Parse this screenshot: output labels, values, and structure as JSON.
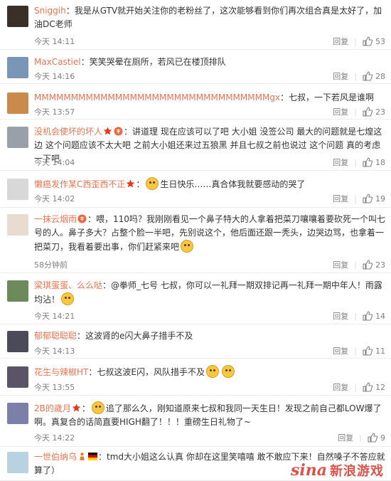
{
  "comments": [
    {
      "user": "Sniggih",
      "sep": "：",
      "text": "我是从GTV就开始关注你的老粉丝了，这次能够看到你们再次组合真是太好了，加油DC老师",
      "time": "今天 14:11",
      "reply": "回复",
      "likes": "53",
      "avatar_color": "#3b2f2a"
    },
    {
      "user": "MaxCastiel",
      "sep": "：",
      "text": "笑笑哭晕在厕所，若风已在楼顶排队",
      "time": "今天 14:16",
      "reply": "回复",
      "likes": "28",
      "avatar_color": "#7a96b6"
    },
    {
      "user": "MMMMMMMMMMMMMMMMMMMMMMMMMMMMMMMMgx",
      "sep": "：",
      "text": "七叔，一下若风是谁啊",
      "time": "今天 13:57",
      "reply": "回复",
      "likes": "23",
      "avatar_color": "#c98a4b"
    },
    {
      "user": "没机会使坏的坏人",
      "sep": "：",
      "text": "讲道理 现在应该可以了吧 大小姐 没签公司 最大的问题就是七煌这边 这个问题应该不太大吧 之前大小姐还来过五狼黑 并且七叔之前也说过 这个问题 真的考虑一下吧",
      "time": "今天 14:04",
      "reply": "回复",
      "likes": "18",
      "avatar_color": "#9aa0a8"
    },
    {
      "user": "懒癌发作某C西歪西不正",
      "sep": "：",
      "text": "生日快乐……真合体我就要感动的哭了",
      "time": "今天 14:02",
      "reply": "回复",
      "likes": "19",
      "avatar_color": "#d8d8d8"
    },
    {
      "user": "一抹云烟雨",
      "sep": "：",
      "text": "喂，110吗？我刚刚看见一个鼻子特大的人拿着把菜刀嚷嚷着要砍死一个叫七号的人。鼻子多大？占整个脸一半吧，先别说这个，他后面还跟一秃头，边哭边骂，也拿着一把菜刀，我看着要出事，你们赶紧来吧",
      "time": "58分钟前",
      "reply": "回复",
      "likes": "23",
      "avatar_color": "#e8dcd0"
    },
    {
      "user": "梁琪蛋蛋、么么哒",
      "sep": "：",
      "text": "@拳师_七号 七叔，你可以一礼拜一期双排记再一礼拜一期中年人！雨露均沾！",
      "time": "今天 14:21",
      "reply": "回复",
      "likes": "14",
      "avatar_color": "#6c8a5a"
    },
    {
      "user": "郁郁聪聪聪",
      "sep": "：",
      "text": "这波肾的e闪大鼻子措手不及",
      "time": "今天 14:13",
      "reply": "回复",
      "likes": "11",
      "avatar_color": "#4a4a58"
    },
    {
      "user": "花生与辣椒HT",
      "sep": "：",
      "text": "七叔这波E闪，风队措手不及",
      "time": "今天 13:55",
      "reply": "回复",
      "likes": "12",
      "avatar_color": "#5b5466"
    },
    {
      "user": "2B的歲月",
      "sep": "：",
      "text": "追了那么久，刚知道原来七叔和我同一天生日！发现之前自己都LOW爆了啊。真复合的话简直要HIGH翻了！！！重磅生日礼物了~",
      "time": "今天 14:22",
      "reply": "回复",
      "likes": "9",
      "avatar_color": "#7c7fa8"
    },
    {
      "user": "一世伯纳乌",
      "sep": "：",
      "text": "tmd大小姐这么认真 你却在这里笑嘻嘻 敢不敢应下来！自然嗓子不答应就算了）",
      "time": "",
      "reply": "",
      "likes": "",
      "avatar_color": "#b9d2e2"
    }
  ],
  "watermark": {
    "brand": "sina",
    "label": "新浪游戏"
  },
  "colors": {
    "username": "#eb7350",
    "meta": "#808080",
    "brand_red": "#d8352a"
  }
}
